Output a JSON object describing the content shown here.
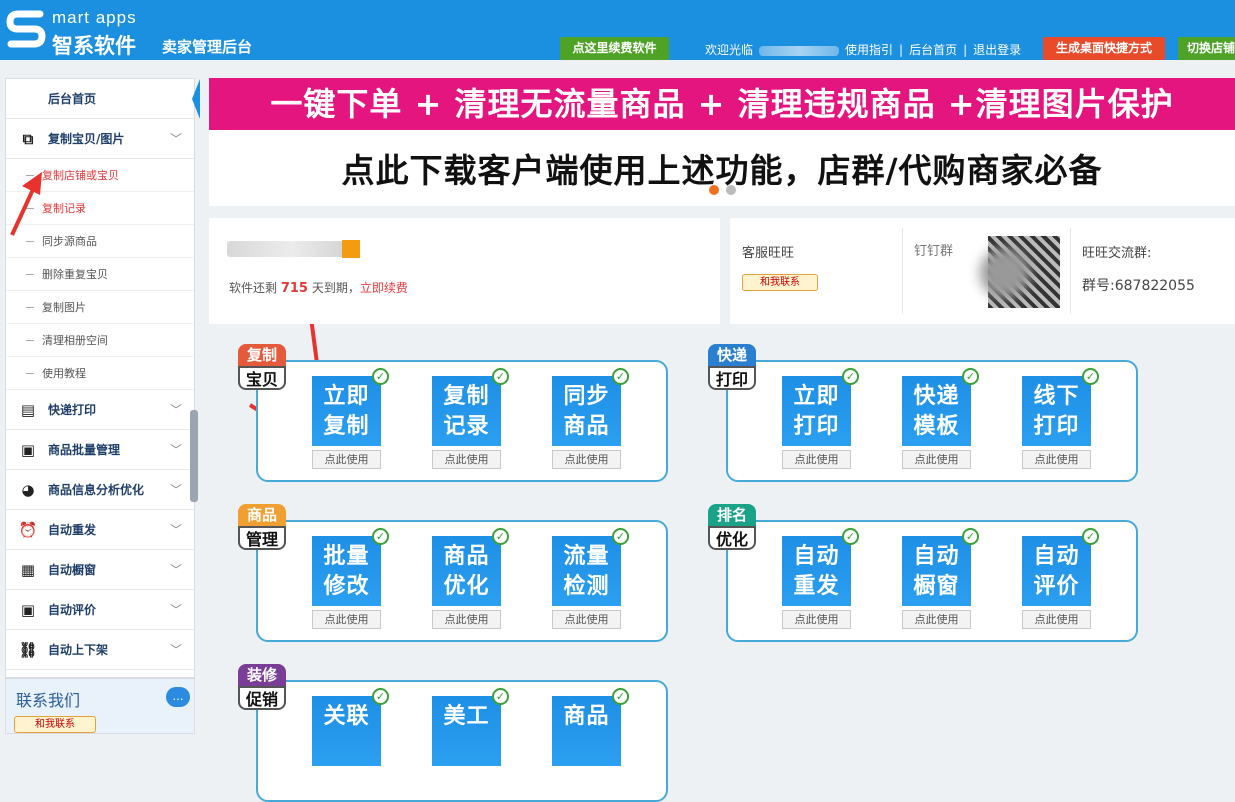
{
  "header": {
    "logo_en": "mart  apps",
    "logo_cn": "智系软件",
    "subtitle": "卖家管理后台",
    "renew_btn": "点这里续费软件",
    "welcome": "欢迎光临",
    "guide": "使用指引",
    "home": "后台首页",
    "logout": "退出登录",
    "shortcut_btn": "生成桌面快捷方式",
    "switch_btn": "切换店铺",
    "sep": "|"
  },
  "sidebar": {
    "home": "后台首页",
    "copy_group": "复制宝贝/图片",
    "sub": [
      "复制店铺或宝贝",
      "复制记录",
      "同步源商品",
      "删除重复宝贝",
      "复制图片",
      "清理相册空间",
      "使用教程"
    ],
    "items": [
      "快递打印",
      "商品批量管理",
      "商品信息分析优化",
      "自动重发",
      "自动橱窗",
      "自动评价",
      "自动上下架"
    ],
    "chevron": "﹀"
  },
  "contact": {
    "title": "联系我们",
    "btn": "和我联系"
  },
  "banner": {
    "line1": "一键下单 + 清理无流量商品 + 清理违规商品 +清理图片保护",
    "line2": "点此下载客户端使用上述功能，店群/代购商家必备"
  },
  "account": {
    "remain_prefix": "软件还剩",
    "days": "715",
    "remain_suffix": "天到期，",
    "renew_link": "立即续费"
  },
  "service": {
    "wangwang": "客服旺旺",
    "contact_btn": "和我联系",
    "dingding": "钉钉群",
    "group_title": "旺旺交流群:",
    "group_no": "群号:687822055"
  },
  "use_label": "点此使用",
  "check": "✓",
  "groups": [
    {
      "tag1": "复制",
      "tag2": "宝贝",
      "color": "#e55a3a",
      "tiles": [
        [
          "立即",
          "复制"
        ],
        [
          "复制",
          "记录"
        ],
        [
          "同步",
          "商品"
        ]
      ]
    },
    {
      "tag1": "快递",
      "tag2": "打印",
      "color": "#2b7fd0",
      "tiles": [
        [
          "立即",
          "打印"
        ],
        [
          "快递",
          "模板"
        ],
        [
          "线下",
          "打印"
        ]
      ]
    },
    {
      "tag1": "商品",
      "tag2": "管理",
      "color": "#f0a030",
      "tiles": [
        [
          "批量",
          "修改"
        ],
        [
          "商品",
          "优化"
        ],
        [
          "流量",
          "检测"
        ]
      ]
    },
    {
      "tag1": "排名",
      "tag2": "优化",
      "color": "#1aa388",
      "tiles": [
        [
          "自动",
          "重发"
        ],
        [
          "自动",
          "橱窗"
        ],
        [
          "自动",
          "评价"
        ]
      ]
    },
    {
      "tag1": "装修",
      "tag2": "促销",
      "color": "#7b3e98",
      "tiles": [
        [
          "关联",
          ""
        ],
        [
          "美工",
          ""
        ],
        [
          "商品",
          ""
        ]
      ]
    }
  ]
}
